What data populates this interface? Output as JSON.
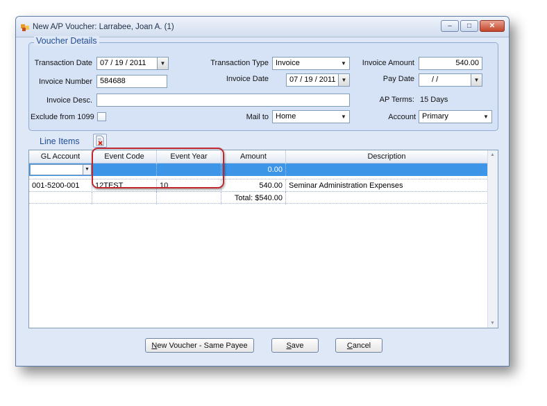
{
  "window": {
    "title": "New A/P Voucher: Larrabee, Joan A. (1)",
    "controls": {
      "minimize": "‒",
      "maximize": "□",
      "close": "✕"
    }
  },
  "voucher_details": {
    "legend": "Voucher Details",
    "transaction_date": {
      "label": "Transaction Date",
      "value": "07 / 19 / 2011"
    },
    "transaction_type": {
      "label": "Transaction Type",
      "value": "Invoice"
    },
    "invoice_amount": {
      "label": "Invoice Amount",
      "value": "540.00"
    },
    "invoice_number": {
      "label": "Invoice Number",
      "value": "584688"
    },
    "invoice_date": {
      "label": "Invoice Date",
      "value": "07 / 19 / 2011"
    },
    "pay_date": {
      "label": "Pay Date",
      "value": "/      /"
    },
    "invoice_desc": {
      "label": "Invoice Desc.",
      "value": ""
    },
    "ap_terms": {
      "label": "AP Terms:",
      "value": "15 Days"
    },
    "exclude_1099": {
      "label": "Exclude from 1099",
      "checked": false
    },
    "mail_to": {
      "label": "Mail to",
      "value": "Home"
    },
    "account": {
      "label": "Account",
      "value": "Primary"
    }
  },
  "line_items": {
    "label": "Line Items",
    "delete_icon": "delete-row-icon",
    "columns": [
      "GL Account",
      "Event Code",
      "Event Year",
      "Amount",
      "Description"
    ],
    "new_row": {
      "gl_account": "",
      "event_code": "",
      "event_year": "",
      "amount": "0.00",
      "description": ""
    },
    "rows": [
      {
        "gl_account": "001-5200-001",
        "event_code": "12TEST",
        "event_year": "10",
        "amount": "540.00",
        "description": "Seminar Administration Expenses"
      }
    ],
    "total": "Total: $540.00"
  },
  "buttons": {
    "new_voucher": {
      "accel": "N",
      "rest": "ew Voucher - Same Payee"
    },
    "save": {
      "accel": "S",
      "rest": "ave"
    },
    "cancel": {
      "accel": "C",
      "rest": "ancel"
    }
  },
  "colors": {
    "selected_row": "#3d95e8",
    "highlight_border": "#c0272d",
    "section_title": "#1f4d96"
  }
}
